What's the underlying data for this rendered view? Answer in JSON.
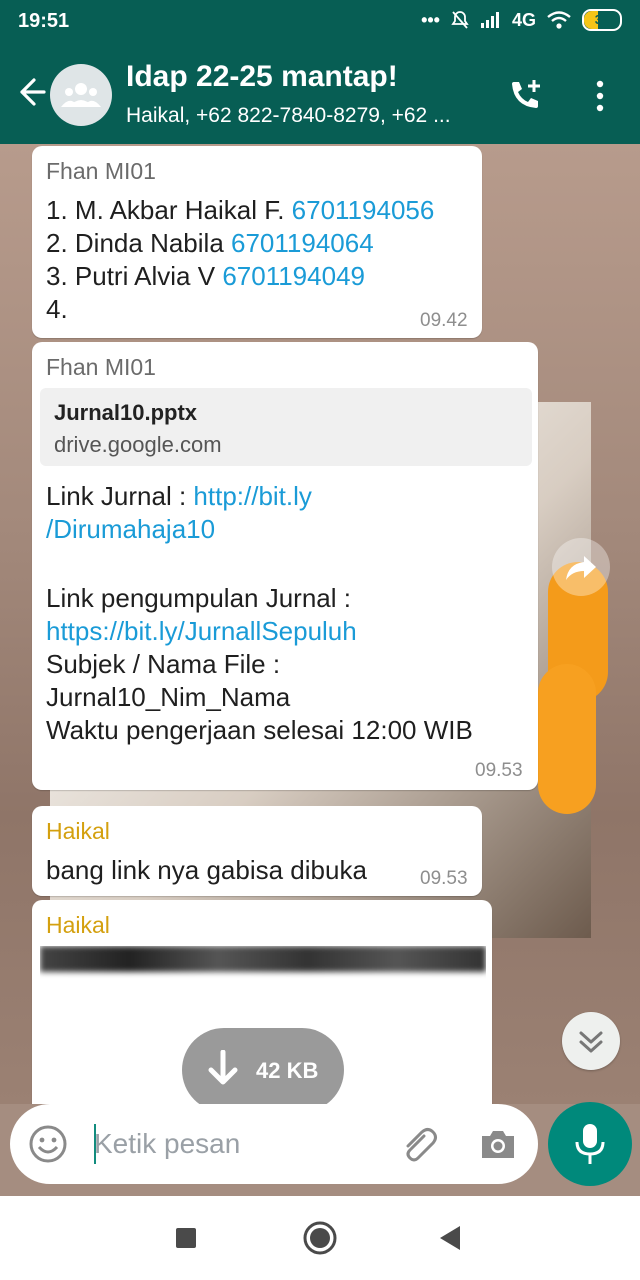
{
  "status_bar": {
    "time": "19:51",
    "network": "4G",
    "battery": "31"
  },
  "header": {
    "title": "Idap 22-25 mantap!",
    "subtitle": "Haikal, +62 822-7840-8279, +62 ..."
  },
  "messages": [
    {
      "sender": "Fhan MI01",
      "lines": [
        {
          "text": "1. M. Akbar Haikal F. ",
          "number": "6701194056"
        },
        {
          "text": "2. Dinda Nabila ",
          "number": "6701194064"
        },
        {
          "text": "3. Putri Alvia V ",
          "number": "6701194049"
        },
        {
          "text": "4.",
          "number": ""
        }
      ],
      "time": "09.42"
    },
    {
      "sender": "Fhan MI01",
      "preview_title": "Jurnal10.pptx",
      "preview_domain": "drive.google.com",
      "link_label": "Link Jurnal : ",
      "link1_part1": "http://bit.ly",
      "link1_part2": "/Dirumahaja10",
      "collect_label": "Link pengumpulan Jurnal :",
      "link2": "https://bit.ly/JurnallSepuluh",
      "subject_label": "Subjek / Nama File :",
      "filename": "Jurnal10_Nim_Nama",
      "deadline": "Waktu pengerjaan selesai 12:00 WIB",
      "time": "09.53"
    },
    {
      "sender": "Haikal",
      "text": "bang link nya gabisa dibuka",
      "time": "09.53"
    },
    {
      "sender": "Haikal",
      "download_size": "42 KB"
    }
  ],
  "input": {
    "placeholder": "Ketik pesan"
  },
  "colors": {
    "header": "#075e54",
    "link": "#1a9bd7",
    "sender_fhan": "#6b6b6b",
    "sender_haikal": "#d4a00f",
    "mic": "#00897b"
  }
}
